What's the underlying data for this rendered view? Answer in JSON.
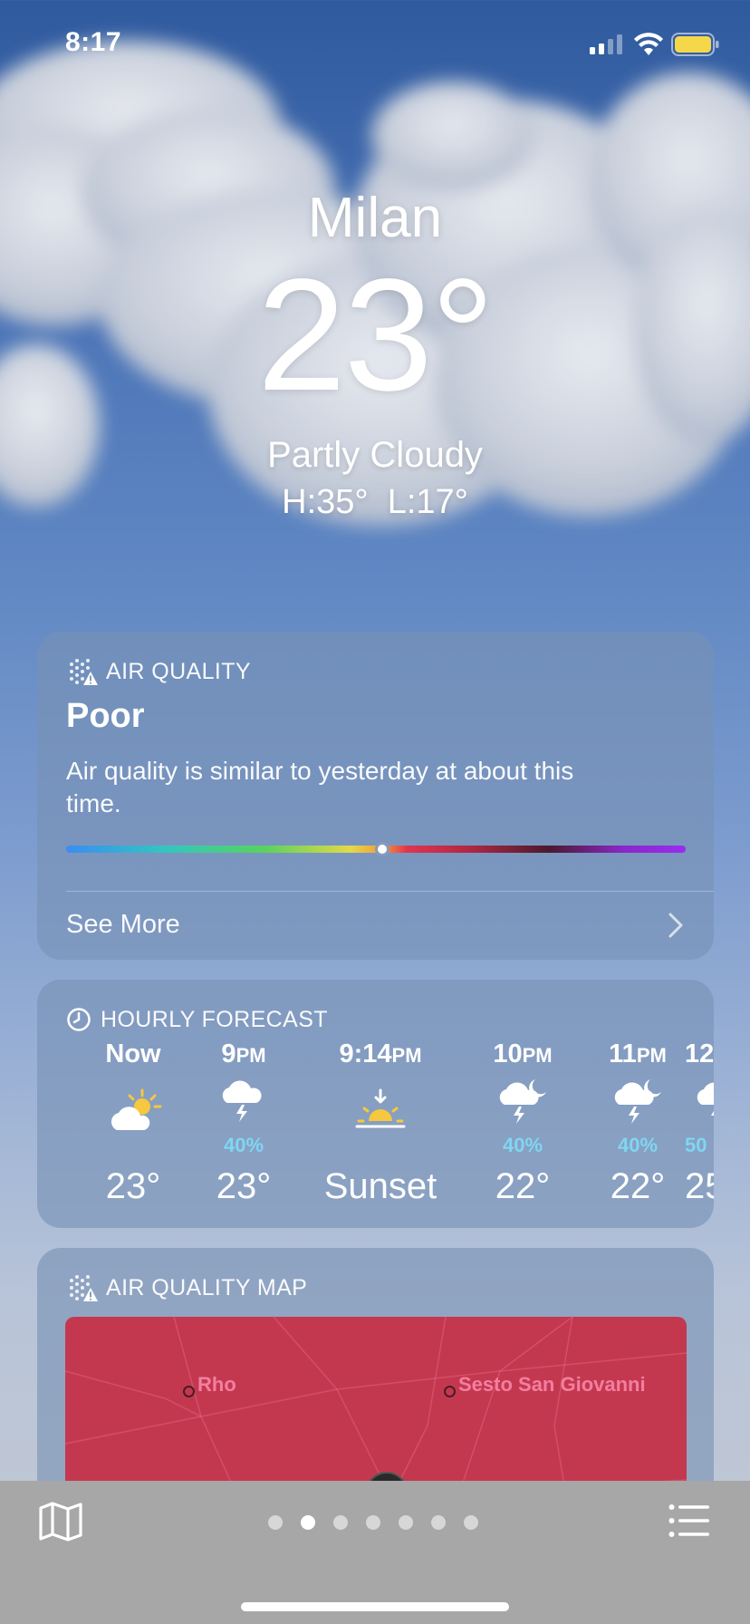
{
  "status_bar": {
    "time": "8:17",
    "icons": [
      "cellular-signal-icon",
      "wifi-icon",
      "battery-icon"
    ],
    "battery_color": "#f4d84a"
  },
  "current": {
    "city": "Milan",
    "temperature": "23°",
    "condition": "Partly Cloudy",
    "high_low": "H:35°  L:17°"
  },
  "air_quality": {
    "header": "AIR QUALITY",
    "icon": "air-quality-warning-icon",
    "level": "Poor",
    "description": "Air quality is similar to yesterday at about this time.",
    "scale_position": 0.51,
    "see_more": "See More"
  },
  "hourly_forecast": {
    "header": "HOURLY FORECAST",
    "icon": "clock-icon",
    "items": [
      {
        "time": "Now",
        "suffix": "",
        "icon": "partly-sunny-icon",
        "pop": "",
        "temp": "23°"
      },
      {
        "time": "9",
        "suffix": "PM",
        "icon": "thunderstorm-icon",
        "pop": "40%",
        "temp": "23°"
      },
      {
        "time": "9:14",
        "suffix": "PM",
        "icon": "sunset-icon",
        "pop": "",
        "temp": "Sunset"
      },
      {
        "time": "10",
        "suffix": "PM",
        "icon": "night-thunderstorm-icon",
        "pop": "40%",
        "temp": "22°"
      },
      {
        "time": "11",
        "suffix": "PM",
        "icon": "night-thunderstorm-icon",
        "pop": "40%",
        "temp": "22°"
      },
      {
        "time": "12",
        "suffix": "",
        "icon": "night-thunderstorm-icon",
        "pop": "50",
        "temp": "25"
      }
    ],
    "precip_color": "#7fd6f3"
  },
  "air_quality_map": {
    "header": "AIR QUALITY MAP",
    "icon": "air-quality-warning-icon",
    "labels": [
      "Rho",
      "Sesto San Giovanni"
    ],
    "map_color": "#c4384f"
  },
  "toolbar": {
    "map_button": "map-icon",
    "list_button": "list-icon",
    "page_count": 7,
    "active_page": 1
  }
}
